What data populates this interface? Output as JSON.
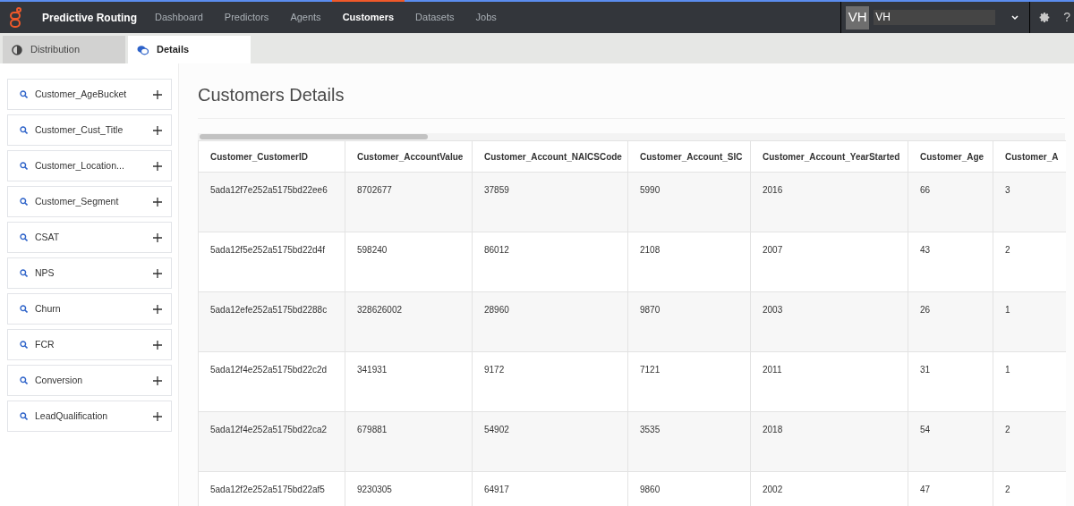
{
  "nav": {
    "brand": "Predictive Routing",
    "items": [
      {
        "label": "Dashboard",
        "selected": false
      },
      {
        "label": "Predictors",
        "selected": false
      },
      {
        "label": "Agents",
        "selected": false
      },
      {
        "label": "Customers",
        "selected": true
      },
      {
        "label": "Datasets",
        "selected": false
      },
      {
        "label": "Jobs",
        "selected": false
      }
    ],
    "avatar": "VH",
    "user": "VH",
    "help": "?"
  },
  "tabs": [
    {
      "label": "Distribution",
      "selected": false
    },
    {
      "label": "Details",
      "selected": true
    }
  ],
  "sidebar": {
    "items": [
      "Customer_AgeBucket",
      "Customer_Cust_Title",
      "Customer_Location...",
      "Customer_Segment",
      "CSAT",
      "NPS",
      "Churn",
      "FCR",
      "Conversion",
      "LeadQualification"
    ]
  },
  "title": "Customers Details",
  "table": {
    "columns": [
      "Customer_CustomerID",
      "Customer_AccountValue",
      "Customer_Account_NAICSCode",
      "Customer_Account_SIC",
      "Customer_Account_YearStarted",
      "Customer_Age",
      "Customer_A"
    ],
    "rows": [
      [
        "5ada12f7e252a5175bd22ee6",
        "8702677",
        "37859",
        "5990",
        "2016",
        "66",
        "3"
      ],
      [
        "5ada12f5e252a5175bd22d4f",
        "598240",
        "86012",
        "2108",
        "2007",
        "43",
        "2"
      ],
      [
        "5ada12efe252a5175bd2288c",
        "328626002",
        "28960",
        "9870",
        "2003",
        "26",
        "1"
      ],
      [
        "5ada12f4e252a5175bd22c2d",
        "341931",
        "9172",
        "7121",
        "2011",
        "31",
        "1"
      ],
      [
        "5ada12f4e252a5175bd22ca2",
        "679881",
        "54902",
        "3535",
        "2018",
        "54",
        "2"
      ],
      [
        "5ada12f2e252a5175bd22af5",
        "9230305",
        "64917",
        "9860",
        "2002",
        "47",
        "2"
      ]
    ]
  }
}
